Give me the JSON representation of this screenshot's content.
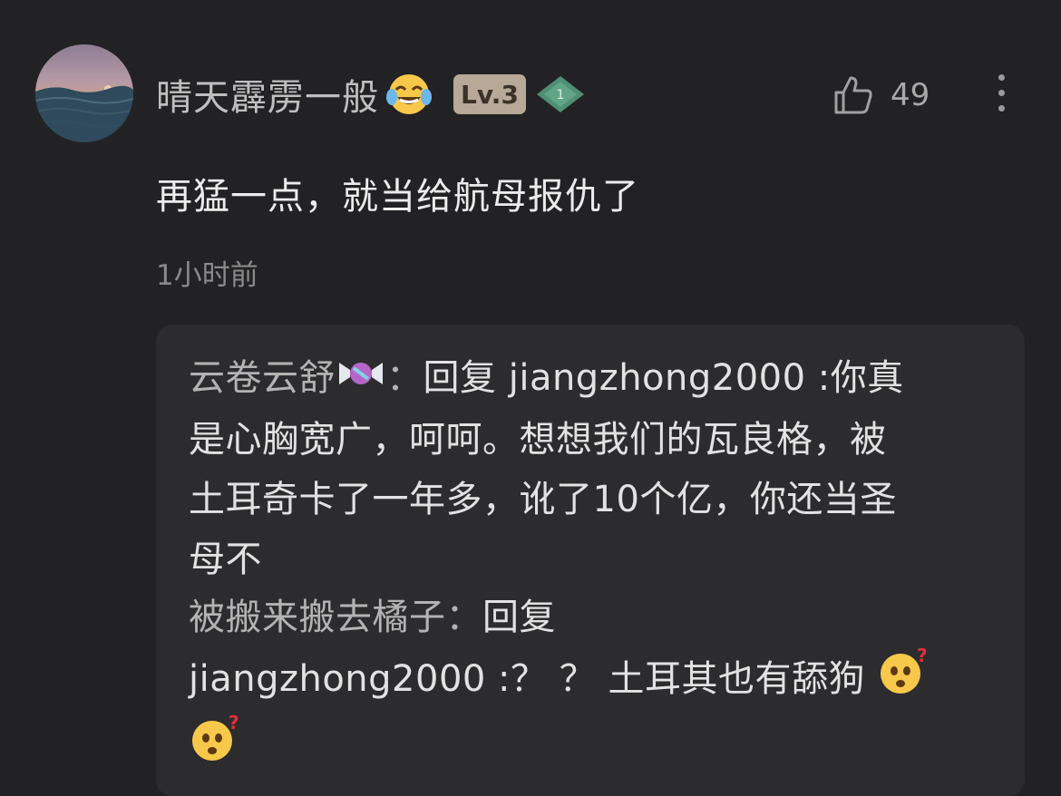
{
  "comment": {
    "username": "晴天霹雳一般",
    "username_emoji": "laughing-tears",
    "level_badge": "Lv.3",
    "gem_badge": "1",
    "like_count": "49",
    "text": "再猛一点，就当给航母报仇了",
    "time": "1小时前"
  },
  "replies": [
    {
      "author": "云卷云舒",
      "author_emoji": "candy",
      "separator": "：",
      "text_line1": "回复 jiangzhong2000 :你真",
      "text_line2": "是心胸宽广，呵呵。想想我们的瓦良格，被",
      "text_line3": "土耳奇卡了一年多，讹了10个亿，你还当圣",
      "text_line4": "母不"
    },
    {
      "author": "被搬来搬去橘子",
      "separator": "：",
      "text_line1": "回复",
      "text_line2": "jiangzhong2000 :？ ？ 土耳其也有舔狗",
      "trailing_emoji": "thinking-face"
    }
  ],
  "colors": {
    "background": "#222224",
    "reply_box": "#2c2c2e",
    "level_badge": "#b7a897",
    "gem": "#4f8f73"
  }
}
